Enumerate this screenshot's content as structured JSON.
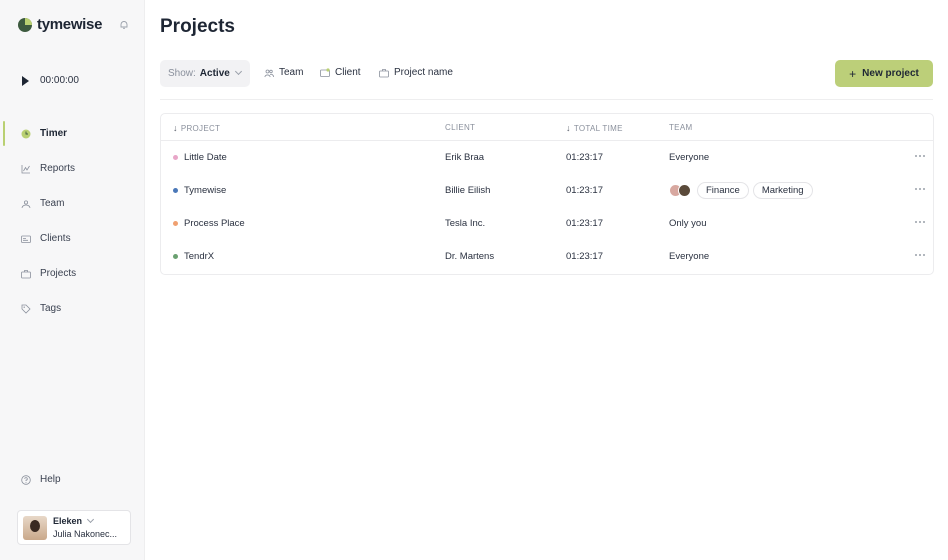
{
  "app": {
    "name": "tymewise"
  },
  "sidebar": {
    "timer_value": "00:00:00",
    "items": [
      {
        "label": "Timer",
        "icon": "timer-icon",
        "active": true
      },
      {
        "label": "Reports",
        "icon": "reports-icon",
        "active": false
      },
      {
        "label": "Team",
        "icon": "team-icon",
        "active": false
      },
      {
        "label": "Clients",
        "icon": "clients-icon",
        "active": false
      },
      {
        "label": "Projects",
        "icon": "projects-icon",
        "active": false
      },
      {
        "label": "Tags",
        "icon": "tags-icon",
        "active": false
      }
    ],
    "help_label": "Help",
    "user": {
      "org": "Eleken",
      "name": "Julia Nakonec..."
    }
  },
  "main": {
    "title": "Projects",
    "filters": {
      "show_label": "Show:",
      "show_value": "Active",
      "team_label": "Team",
      "client_label": "Client",
      "project_name_label": "Project name"
    },
    "new_project_label": "New project",
    "table": {
      "columns": [
        "PROJECT",
        "CLIENT",
        "TOTAL TIME",
        "TEAM"
      ],
      "rows": [
        {
          "project": "Little Date",
          "dot_color": "#e8a6c8",
          "client": "Erik Braa",
          "time": "01:23:17",
          "team": "Everyone"
        },
        {
          "project": "Tymewise",
          "dot_color": "#4a78b8",
          "client": "Billie Eilish",
          "time": "01:23:17",
          "team_tags": [
            "Finance",
            "Marketing"
          ]
        },
        {
          "project": "Process Place",
          "dot_color": "#f0a070",
          "client": "Tesla Inc.",
          "time": "01:23:17",
          "team": "Only you"
        },
        {
          "project": "TendrX",
          "dot_color": "#6aa070",
          "client": "Dr. Martens",
          "time": "01:23:17",
          "team": "Everyone"
        }
      ]
    }
  },
  "colors": {
    "accent": "#bccf79",
    "brand_dark": "#3d5a3f"
  }
}
